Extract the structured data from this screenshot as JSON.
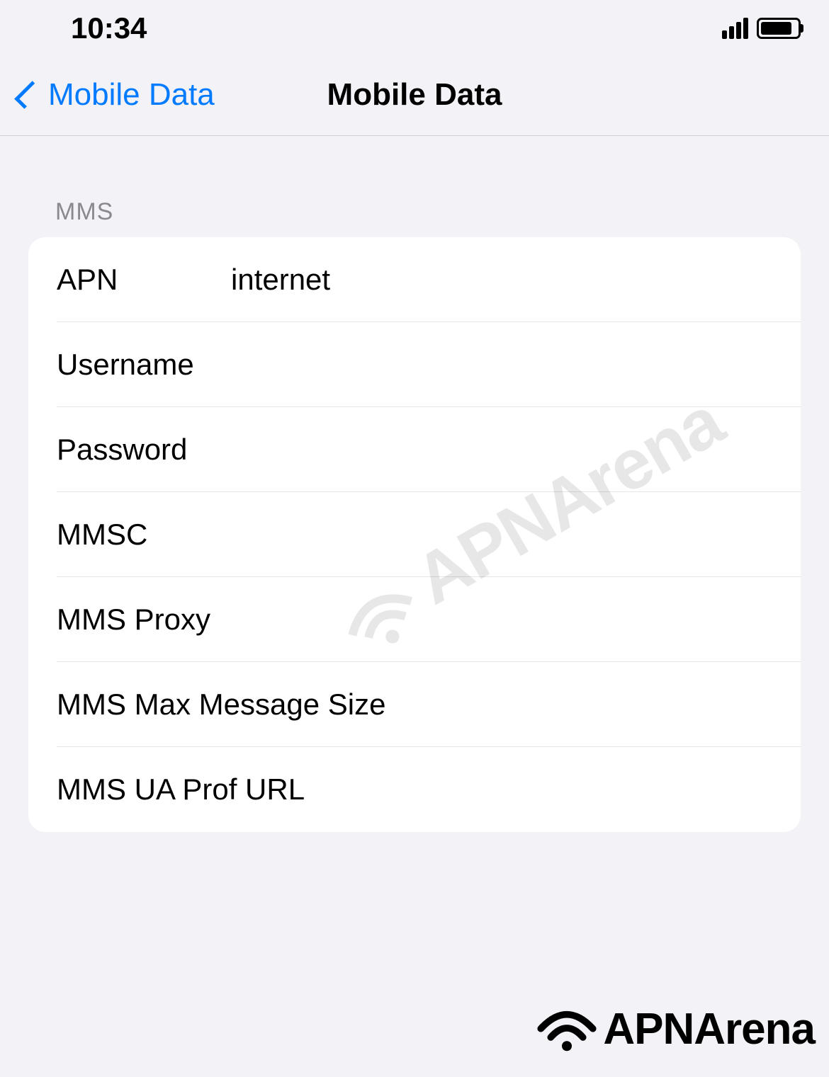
{
  "status_bar": {
    "time": "10:34"
  },
  "nav": {
    "back_label": "Mobile Data",
    "title": "Mobile Data"
  },
  "section_header": "MMS",
  "fields": {
    "apn": {
      "label": "APN",
      "value": "internet"
    },
    "username": {
      "label": "Username",
      "value": ""
    },
    "password": {
      "label": "Password",
      "value": ""
    },
    "mmsc": {
      "label": "MMSC",
      "value": ""
    },
    "mms_proxy": {
      "label": "MMS Proxy",
      "value": ""
    },
    "mms_max_size": {
      "label": "MMS Max Message Size",
      "value": ""
    },
    "mms_ua_prof": {
      "label": "MMS UA Prof URL",
      "value": ""
    }
  },
  "watermark": "APNArena",
  "logo_text": "APNArena"
}
